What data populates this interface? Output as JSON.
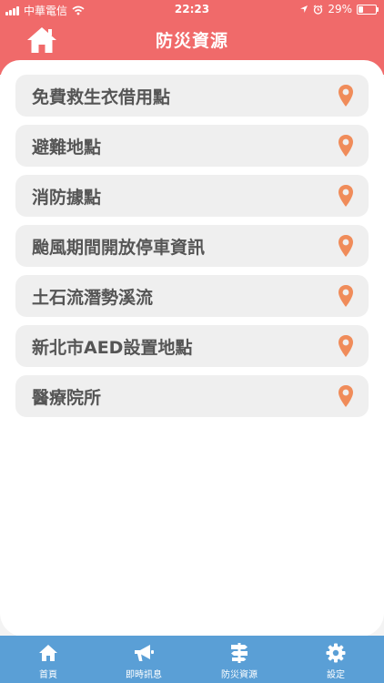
{
  "status_bar": {
    "carrier": "中華電信",
    "time": "22:23",
    "battery_percent": "29%",
    "battery_level": 0.29,
    "icons": [
      "signal-icon",
      "wifi-icon",
      "location-arrow-icon",
      "alarm-icon",
      "battery-icon"
    ]
  },
  "header": {
    "title": "防災資源",
    "home_icon": "home-icon"
  },
  "list": {
    "items": [
      {
        "label": "免費救生衣借用點",
        "icon": "map-pin-icon"
      },
      {
        "label": "避難地點",
        "icon": "map-pin-icon"
      },
      {
        "label": "消防據點",
        "icon": "map-pin-icon"
      },
      {
        "label": "颱風期間開放停車資訊",
        "icon": "map-pin-icon"
      },
      {
        "label": "土石流潛勢溪流",
        "icon": "map-pin-icon"
      },
      {
        "label": "新北市AED設置地點",
        "icon": "map-pin-icon"
      },
      {
        "label": "醫療院所",
        "icon": "map-pin-icon"
      }
    ]
  },
  "tabbar": {
    "tabs": [
      {
        "label": "首頁",
        "icon": "home-icon"
      },
      {
        "label": "即時訊息",
        "icon": "megaphone-icon"
      },
      {
        "label": "防災資源",
        "icon": "signpost-icon",
        "active": true
      },
      {
        "label": "設定",
        "icon": "gear-icon"
      }
    ]
  },
  "colors": {
    "header": "#f06a6a",
    "tabbar": "#5a9fd6",
    "pin": "#f08c5a",
    "row_bg": "#efefef",
    "row_text": "#555555"
  }
}
